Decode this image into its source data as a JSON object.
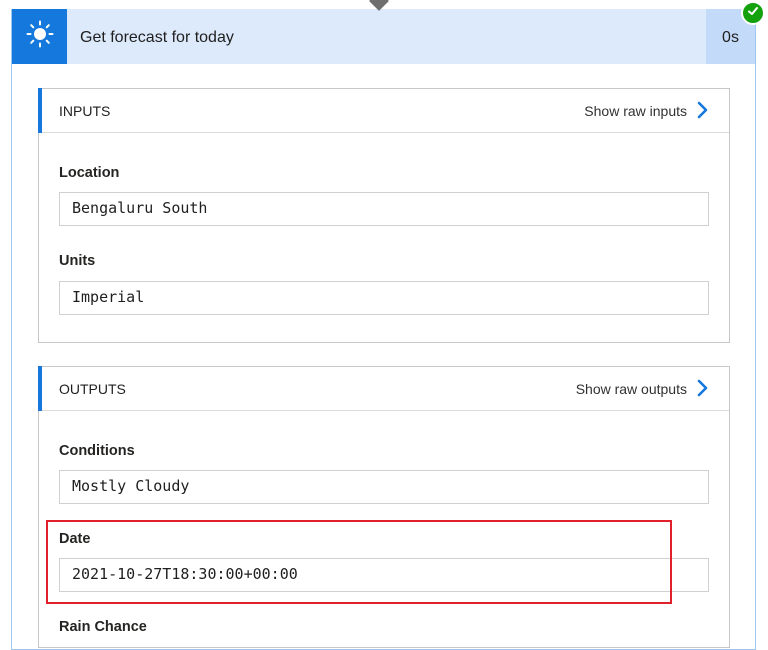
{
  "action": {
    "title": "Get forecast for today",
    "duration": "0s",
    "icon": "sun-icon",
    "status_icon": "checkmark-icon",
    "accent_color": "#1478dc",
    "status_color": "#13a10e"
  },
  "inputs": {
    "heading": "INPUTS",
    "raw_link": "Show raw inputs",
    "fields": [
      {
        "label": "Location",
        "value": "Bengaluru South"
      },
      {
        "label": "Units",
        "value": "Imperial"
      }
    ]
  },
  "outputs": {
    "heading": "OUTPUTS",
    "raw_link": "Show raw outputs",
    "fields": [
      {
        "label": "Conditions",
        "value": "Mostly Cloudy"
      },
      {
        "label": "Date",
        "value": "2021-10-27T18:30:00+00:00"
      },
      {
        "label": "Rain Chance",
        "value": ""
      }
    ]
  },
  "highlight_color": "#e0202a"
}
